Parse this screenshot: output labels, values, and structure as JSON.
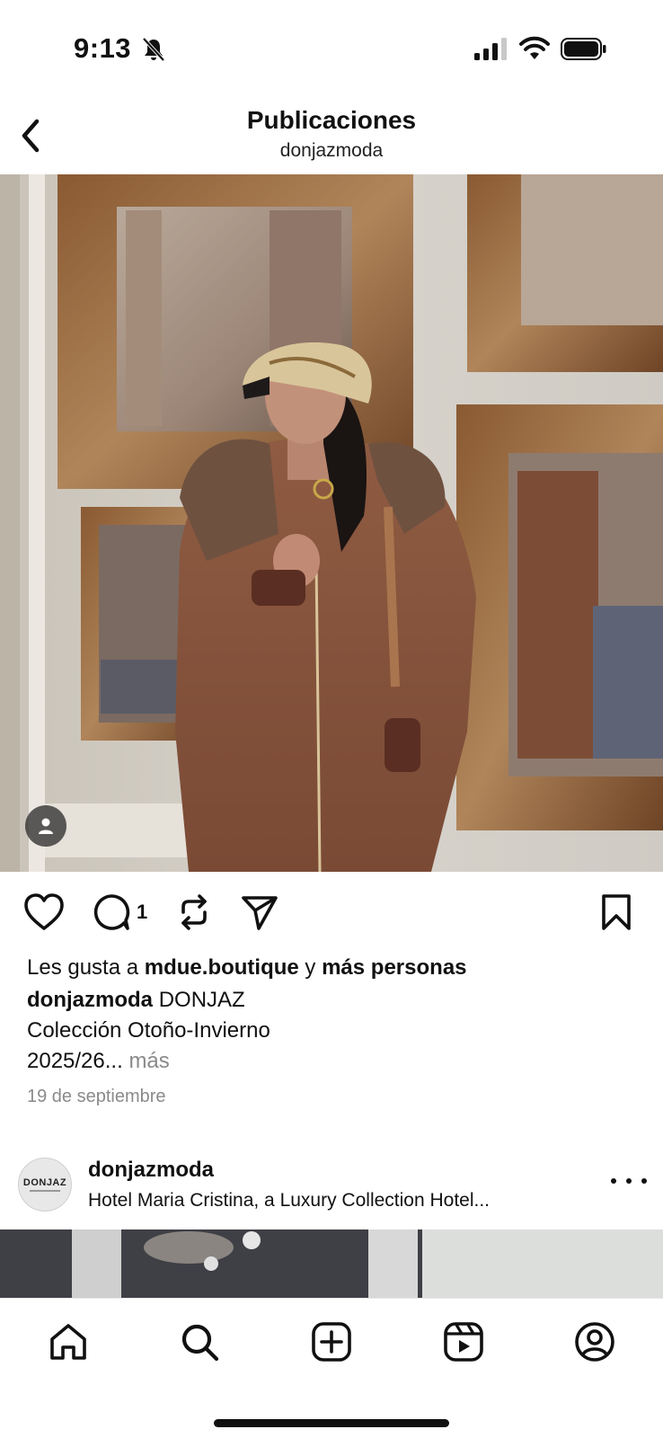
{
  "status_bar": {
    "time": "9:13",
    "icons": [
      "bell-slash-icon",
      "signal-icon",
      "wifi-icon",
      "battery-icon"
    ]
  },
  "header": {
    "title": "Publicaciones",
    "subtitle": "donjazmoda",
    "back_icon": "chevron-left-icon"
  },
  "post": {
    "actions": {
      "like_icon": "heart-icon",
      "comment_icon": "comment-icon",
      "comment_count": "1",
      "repost_icon": "repost-icon",
      "share_icon": "send-icon",
      "save_icon": "bookmark-icon"
    },
    "likes": {
      "prefix": "Les gusta a",
      "user": "mdue.boutique",
      "connector": "y",
      "others": "más personas"
    },
    "caption": {
      "username": "donjazmoda",
      "line1_text": "DONJAZ",
      "line2": "Colección Otoño-Invierno",
      "line3": "2025/26...",
      "more": "más"
    },
    "date": "19 de septiembre"
  },
  "next_post": {
    "avatar_text": "DONJAZ",
    "username": "donjazmoda",
    "location": "Hotel Maria Cristina, a Luxury Collection Hotel..."
  },
  "bottom_nav": {
    "items": [
      "home-icon",
      "search-icon",
      "create-icon",
      "reels-icon",
      "profile-icon"
    ]
  },
  "colors": {
    "text": "#111111",
    "secondary_text": "#8a8a8a",
    "background": "#ffffff"
  }
}
